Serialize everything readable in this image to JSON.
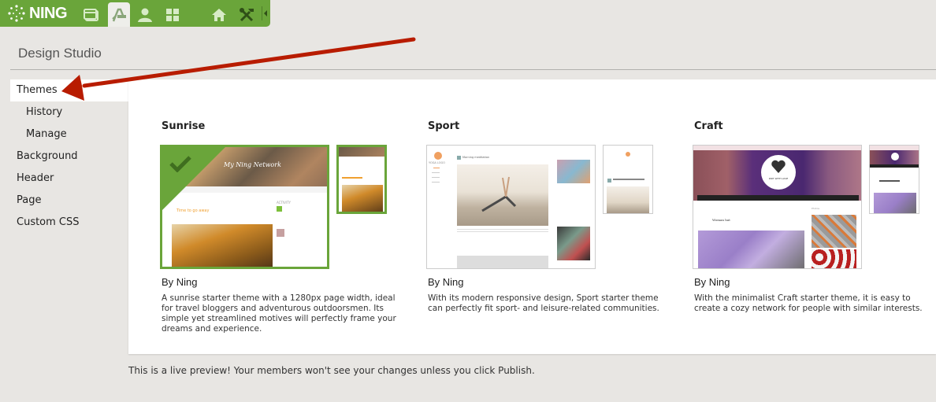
{
  "topbar": {
    "logo_text": "NING",
    "icons": [
      {
        "name": "pages-icon",
        "active": false
      },
      {
        "name": "design-studio-icon",
        "active": true
      },
      {
        "name": "members-icon",
        "active": false
      },
      {
        "name": "apps-icon",
        "active": false
      },
      {
        "name": "home-icon",
        "active": false
      },
      {
        "name": "tools-icon",
        "active": false
      }
    ]
  },
  "header": {
    "title": "Design Studio"
  },
  "sidebar": {
    "items": [
      {
        "label": "Themes",
        "active": true,
        "sub": false
      },
      {
        "label": "History",
        "active": false,
        "sub": true
      },
      {
        "label": "Manage",
        "active": false,
        "sub": true
      },
      {
        "label": "Background",
        "active": false,
        "sub": false
      },
      {
        "label": "Header",
        "active": false,
        "sub": false
      },
      {
        "label": "Page",
        "active": false,
        "sub": false
      },
      {
        "label": "Custom CSS",
        "active": false,
        "sub": false
      }
    ]
  },
  "themes": [
    {
      "name": "Sunrise",
      "author": "By Ning",
      "description": "A sunrise starter theme with a 1280px page width, ideal for travel bloggers and adventurous outdoorsmen. Its simple yet streamlined motives will perfectly frame your dreams and experience.",
      "selected": true,
      "preview_title": "My Ning Network",
      "preview_post": "Time to go away",
      "preview_sidebar": "ACTIVITY"
    },
    {
      "name": "Sport",
      "author": "By Ning",
      "description": "With its modern responsive design, Sport starter theme can perfectly fit sport- and leisure-related communities.",
      "selected": false,
      "preview_title": "YOGA LOGO",
      "preview_post": "Morning meditation"
    },
    {
      "name": "Craft",
      "author": "By Ning",
      "description": "With the minimalist Craft starter theme, it is easy to create a cozy network for people with similar interests.",
      "selected": false,
      "preview_title": "KNIT WITH LOVE",
      "preview_post": "Woman hat",
      "preview_sidebar": "Photos"
    }
  ],
  "footer": {
    "note": "This is a live preview! Your members won't see your changes unless you click Publish."
  },
  "colors": {
    "brand_green": "#6aa53a",
    "annotation_arrow": "#b81c00",
    "background": "#e8e6e3"
  }
}
